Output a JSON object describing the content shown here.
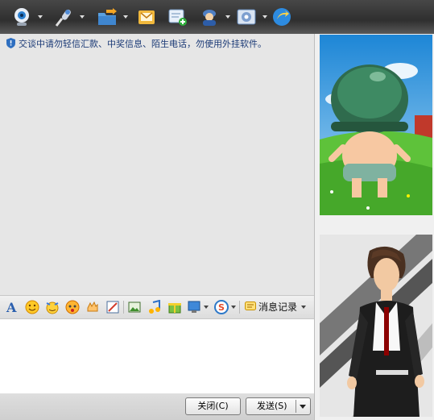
{
  "toolbar": {
    "buttons": [
      {
        "name": "video-icon",
        "has_dropdown": true
      },
      {
        "name": "microphone-icon",
        "has_dropdown": true
      },
      {
        "name": "send-file-icon",
        "has_dropdown": true
      },
      {
        "name": "email-icon",
        "has_dropdown": false
      },
      {
        "name": "create-group-icon",
        "has_dropdown": false
      },
      {
        "name": "contact-card-icon",
        "has_dropdown": true
      },
      {
        "name": "app-settings-icon",
        "has_dropdown": true
      },
      {
        "name": "share-icon",
        "has_dropdown": false
      }
    ]
  },
  "chat": {
    "warning_text": "交谈中请勿轻信汇款、中奖信息、陌生电话，勿使用外挂软件。"
  },
  "format_bar": {
    "items": [
      "font-icon",
      "emoticon-icon",
      "magic-emoticon-icon",
      "nudge-icon",
      "gesture-icon",
      "screenshot-icon",
      "image-icon",
      "music-icon",
      "gift-icon",
      "remote-desktop-icon",
      "payment-icon"
    ],
    "history_label": "消息记录"
  },
  "actions": {
    "close_label": "关闭(C)",
    "send_label": "发送(S)"
  },
  "colors": {
    "toolbar_bg": "#3a3a3a",
    "warning_text": "#1b3a76",
    "chat_bg": "#e6e6e6"
  }
}
